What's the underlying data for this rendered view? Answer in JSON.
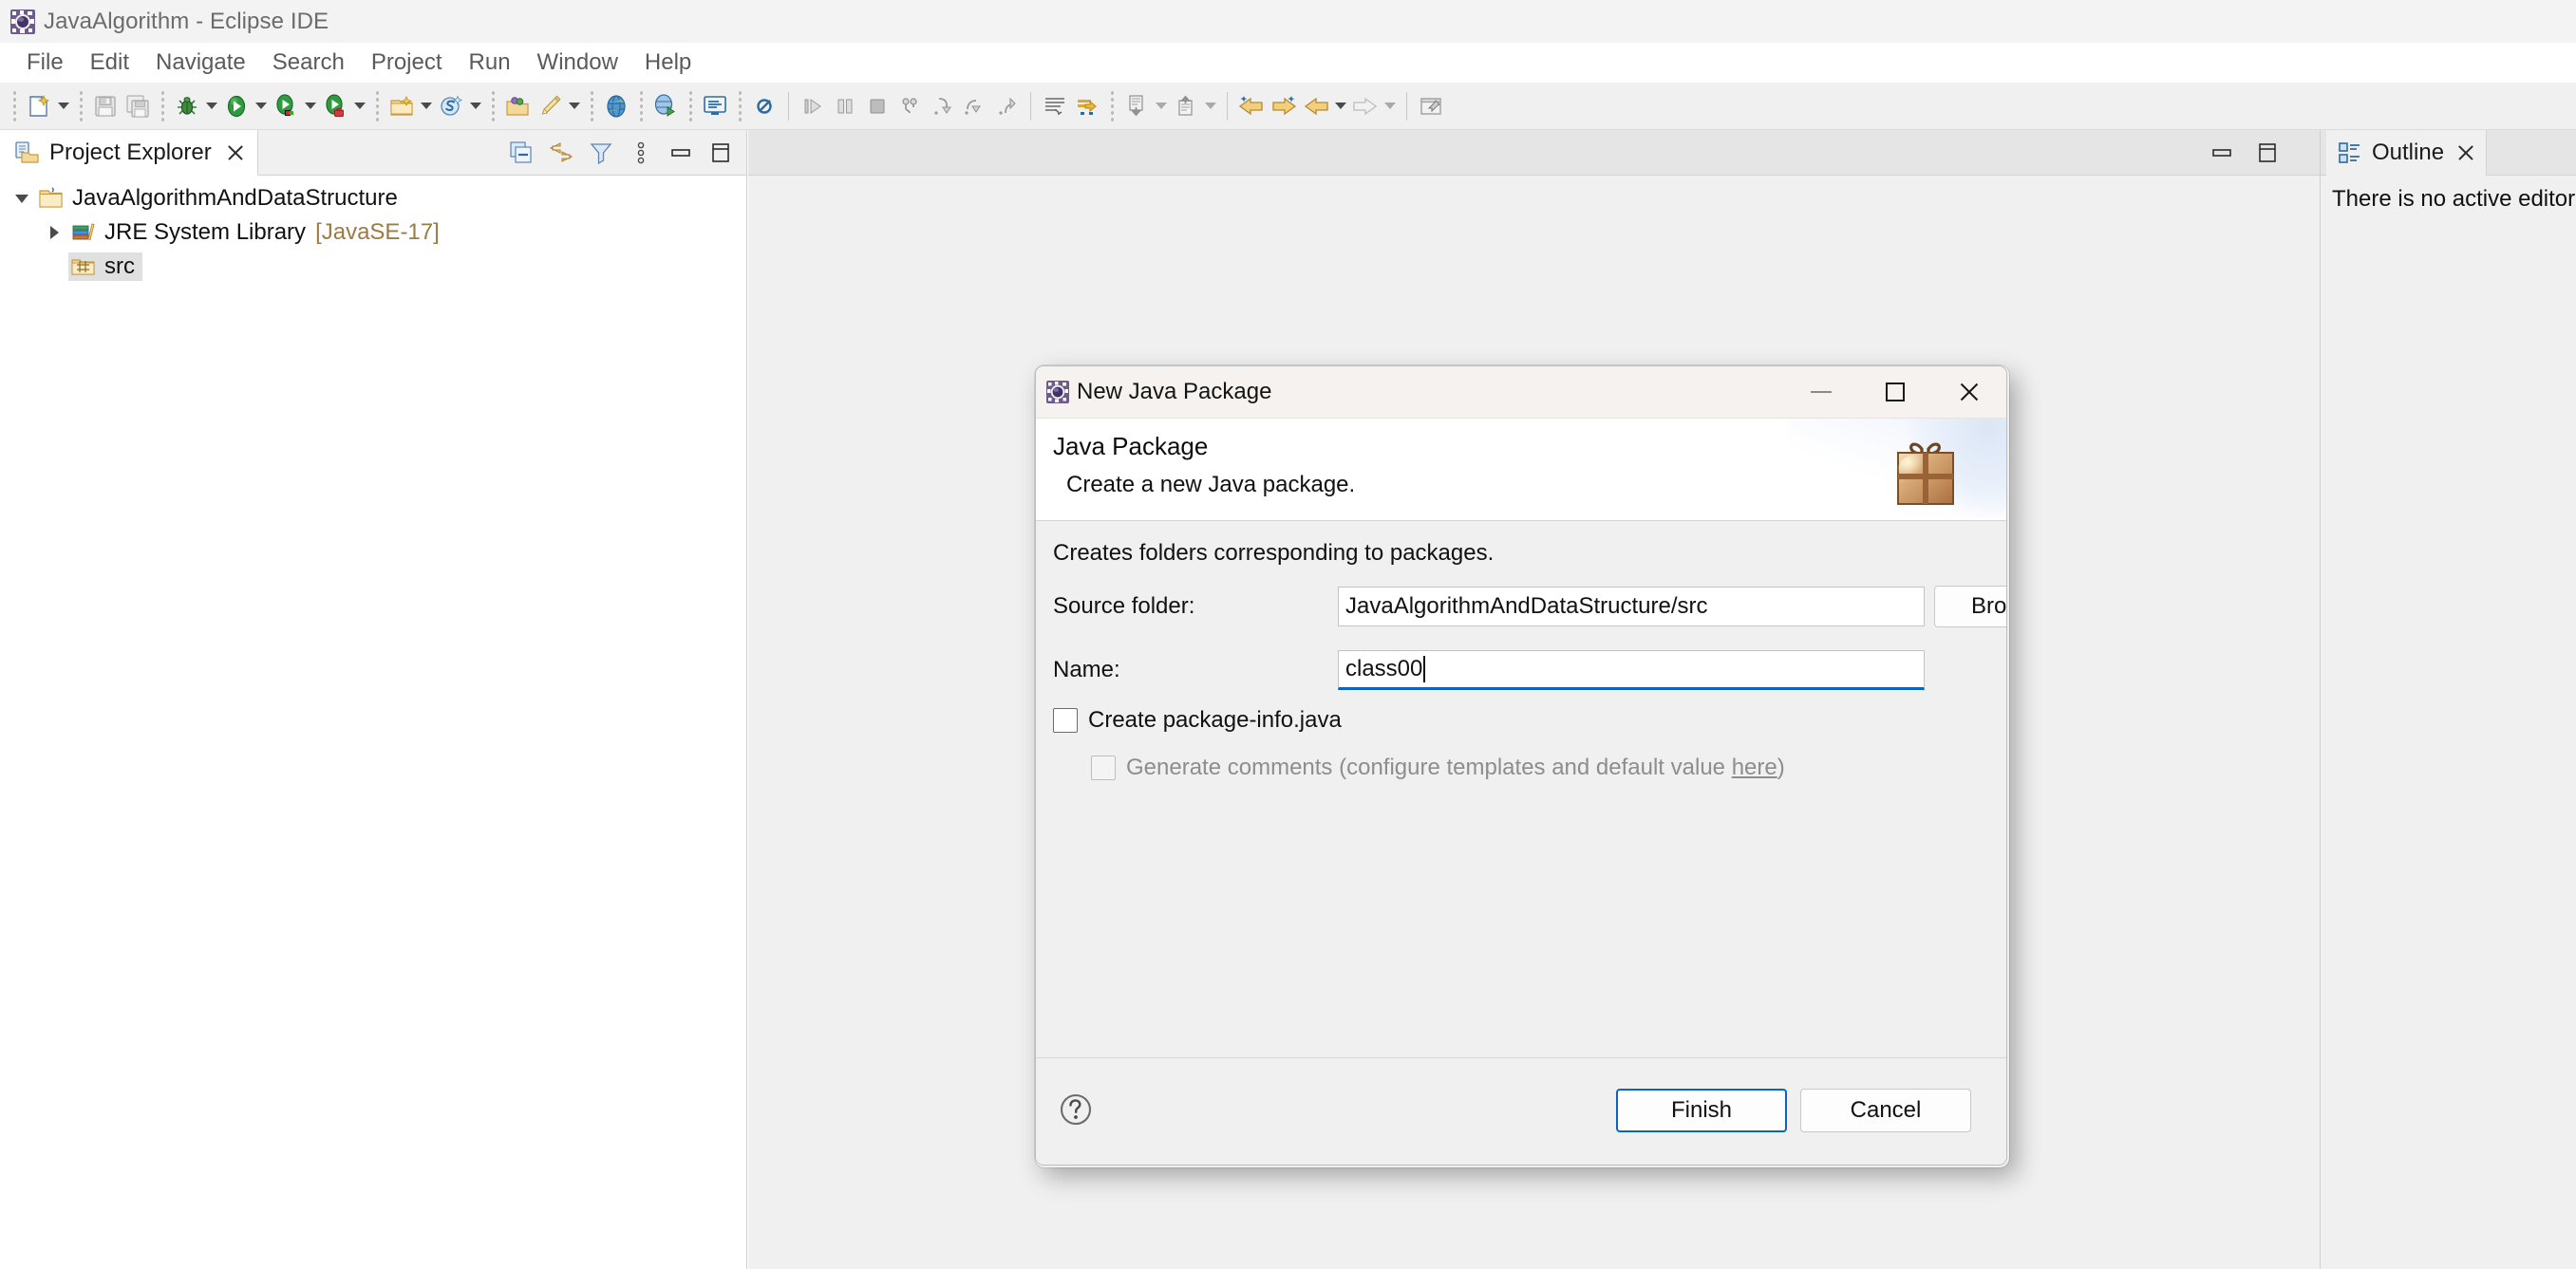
{
  "window": {
    "title": "JavaAlgorithm - Eclipse IDE",
    "app_icon": "eclipse-icon"
  },
  "menubar": {
    "items": [
      {
        "label": "File"
      },
      {
        "label": "Edit"
      },
      {
        "label": "Navigate"
      },
      {
        "label": "Search"
      },
      {
        "label": "Project"
      },
      {
        "label": "Run"
      },
      {
        "label": "Window"
      },
      {
        "label": "Help"
      }
    ]
  },
  "toolbar": {
    "groups": [
      {
        "buttons": [
          {
            "icon": "new-wizard-icon",
            "dropdown": true
          }
        ]
      },
      {
        "buttons": [
          {
            "icon": "save-icon",
            "dropdown": false
          },
          {
            "icon": "save-all-icon",
            "dropdown": false
          }
        ]
      },
      {
        "buttons": [
          {
            "icon": "debug-icon",
            "dropdown": true
          },
          {
            "icon": "run-icon",
            "dropdown": true
          },
          {
            "icon": "coverage-icon",
            "dropdown": true
          },
          {
            "icon": "external-tools-icon",
            "dropdown": true
          }
        ]
      },
      {
        "buttons": [
          {
            "icon": "new-java-project-icon",
            "dropdown": true
          },
          {
            "icon": "new-scout-project-icon",
            "dropdown": true
          }
        ]
      },
      {
        "buttons": [
          {
            "icon": "open-type-icon",
            "dropdown": false
          },
          {
            "icon": "new-class-icon",
            "dropdown": true
          }
        ]
      },
      {
        "buttons": [
          {
            "icon": "open-task-icon",
            "dropdown": false
          }
        ]
      },
      {
        "buttons": [
          {
            "icon": "search-globe-icon",
            "dropdown": false
          }
        ]
      },
      {
        "buttons": [
          {
            "icon": "console-icon",
            "dropdown": false
          }
        ]
      },
      {
        "buttons": [
          {
            "icon": "skip-breakpoints-icon",
            "dropdown": false
          }
        ]
      },
      {
        "buttons": [
          {
            "icon": "resume-icon",
            "dropdown": false
          },
          {
            "icon": "suspend-icon",
            "dropdown": false
          },
          {
            "icon": "terminate-icon",
            "dropdown": false
          },
          {
            "icon": "disconnect-icon",
            "dropdown": false
          },
          {
            "icon": "step-into-icon",
            "dropdown": false
          },
          {
            "icon": "step-over-icon",
            "dropdown": false
          },
          {
            "icon": "step-return-icon",
            "dropdown": false
          }
        ]
      },
      {
        "buttons": [
          {
            "icon": "next-annotation-icon",
            "dropdown": false
          },
          {
            "icon": "last-edit-location-icon",
            "dropdown": false
          }
        ]
      },
      {
        "buttons": [
          {
            "icon": "previous-edit-icon",
            "dropdown": true
          },
          {
            "icon": "next-edit-icon",
            "dropdown": true
          }
        ]
      },
      {
        "buttons": [
          {
            "icon": "back-star-icon",
            "dropdown": false
          },
          {
            "icon": "forward-star-icon",
            "dropdown": false
          },
          {
            "icon": "back-arrow-icon",
            "dropdown": true
          },
          {
            "icon": "forward-arrow-icon",
            "dropdown": true
          }
        ]
      },
      {
        "buttons": [
          {
            "icon": "pin-editor-icon",
            "dropdown": false
          }
        ]
      }
    ]
  },
  "project_explorer": {
    "tab_label": "Project Explorer",
    "tab_icon": "project-explorer-icon",
    "close_icon": "close-icon",
    "toolbar_icons": [
      "collapse-all-icon",
      "link-with-editor-icon",
      "view-filters-icon",
      "view-menu-icon",
      "minimize-icon",
      "maximize-icon"
    ],
    "tree": [
      {
        "label": "JavaAlgorithmAndDataStructure",
        "icon": "java-project-icon",
        "expanded": true,
        "indent": 0,
        "selected": false,
        "suffix": ""
      },
      {
        "label": "JRE System Library",
        "icon": "jre-library-icon",
        "expanded": false,
        "indent": 1,
        "selected": false,
        "suffix": "[JavaSE-17]"
      },
      {
        "label": "src",
        "icon": "source-folder-icon",
        "expanded": null,
        "indent": 1,
        "selected": true,
        "suffix": ""
      }
    ]
  },
  "editor_area": {
    "minimize_icon": "minimize-icon",
    "maximize_icon": "maximize-icon"
  },
  "outline": {
    "tab_label": "Outline",
    "tab_icon": "outline-icon",
    "close_icon": "close-icon",
    "message": "There is no active editor that provides an outline."
  },
  "dialog": {
    "title": "New Java Package",
    "title_icon": "eclipse-icon",
    "window_buttons": {
      "minimize": "minimize-icon",
      "maximize": "maximize-icon",
      "close": "close-icon"
    },
    "banner": {
      "heading": "Java Package",
      "subtitle": "Create a new Java package.",
      "image": "gift-box-icon"
    },
    "description": "Creates folders corresponding to packages.",
    "fields": [
      {
        "label": "Source folder:",
        "value": "JavaAlgorithmAndDataStructure/src",
        "placeholder": "",
        "focused": false,
        "button": "Browse..."
      },
      {
        "label": "Name:",
        "value": "class00",
        "placeholder": "",
        "focused": true,
        "button": null
      }
    ],
    "checkboxes": [
      {
        "label": "Create package-info.java",
        "checked": false,
        "disabled": false
      },
      {
        "label_prefix": "Generate comments (configure templates and default value ",
        "link": "here",
        "label_suffix": ")",
        "checked": false,
        "disabled": true
      }
    ],
    "footer": {
      "help_icon": "help-icon",
      "finish_label": "Finish",
      "cancel_label": "Cancel"
    }
  },
  "colors": {
    "accent": "#0a64c8",
    "titlebar_bg": "#f3f3f3",
    "toolbar_bg": "#f0f0f0",
    "dialog_bg": "#f0f0f0",
    "dialog_titlebar_bg": "#f5f2ef",
    "selection_bg": "#e0e0e0",
    "tree_suffix_fg": "#9c7b42",
    "disabled_fg": "#8d8d8d"
  }
}
